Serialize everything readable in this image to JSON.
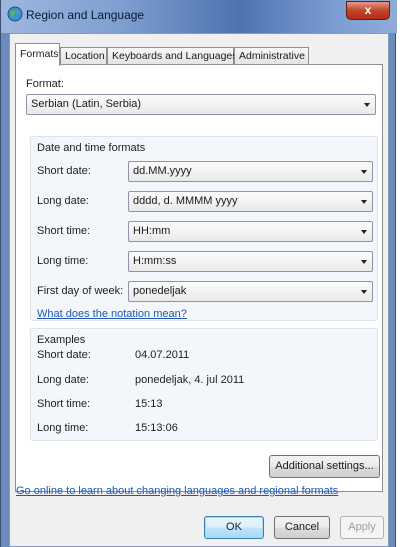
{
  "window": {
    "title": "Region and Language",
    "close_label": "x"
  },
  "tabs": [
    {
      "label": "Formats",
      "active": true
    },
    {
      "label": "Location",
      "active": false
    },
    {
      "label": "Keyboards and Languages",
      "active": false
    },
    {
      "label": "Administrative",
      "active": false
    }
  ],
  "format": {
    "label": "Format:",
    "value": "Serbian (Latin, Serbia)"
  },
  "date_time": {
    "title": "Date and time formats",
    "short_date": {
      "label": "Short date:",
      "value": "dd.MM.yyyy"
    },
    "long_date": {
      "label": "Long date:",
      "value": "dddd, d. MMMM yyyy"
    },
    "short_time": {
      "label": "Short time:",
      "value": "HH:mm"
    },
    "long_time": {
      "label": "Long time:",
      "value": "H:mm:ss"
    },
    "first_day": {
      "label": "First day of week:",
      "value": "ponedeljak"
    }
  },
  "notation_link": "What does the notation mean?",
  "examples": {
    "title": "Examples",
    "short_date": {
      "label": "Short date:",
      "value": "04.07.2011"
    },
    "long_date": {
      "label": "Long date:",
      "value": "ponedeljak, 4. jul 2011"
    },
    "short_time": {
      "label": "Short time:",
      "value": "15:13"
    },
    "long_time": {
      "label": "Long time:",
      "value": "15:13:06"
    }
  },
  "additional_settings": "Additional settings...",
  "online_link": "Go online to learn about changing languages and regional formats",
  "buttons": {
    "ok": "OK",
    "cancel": "Cancel",
    "apply": "Apply"
  }
}
